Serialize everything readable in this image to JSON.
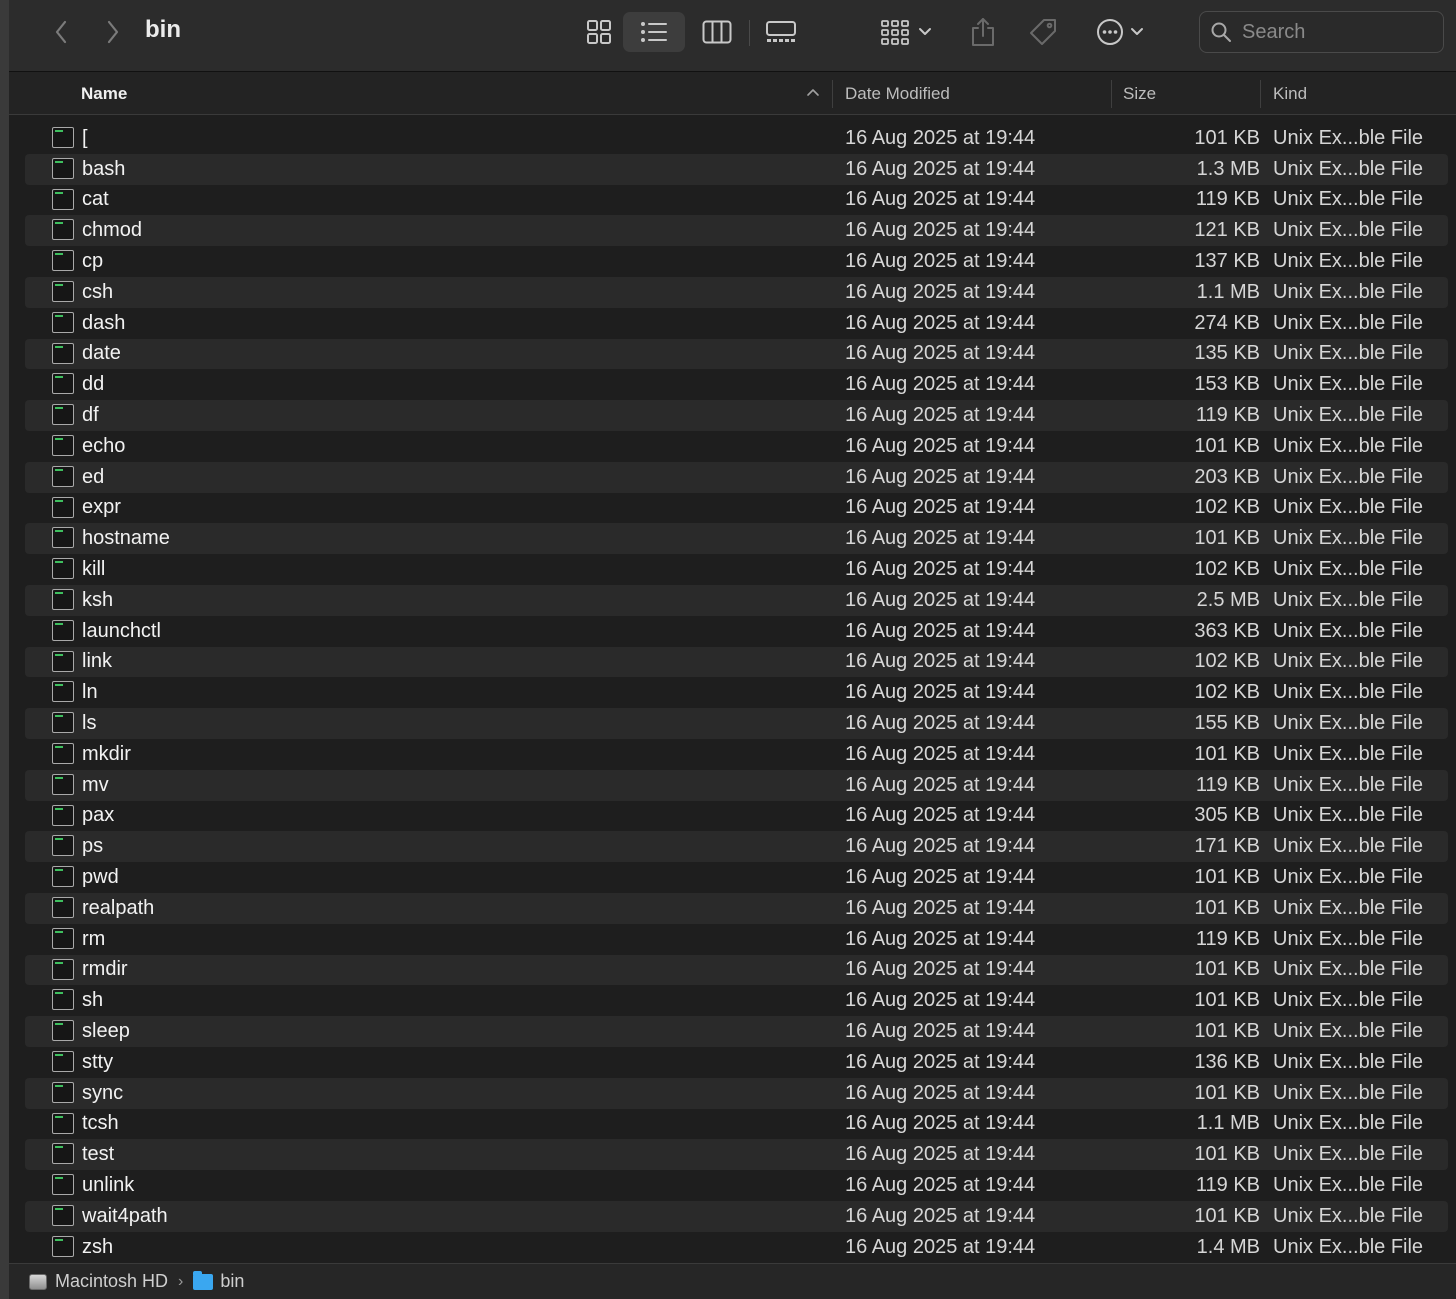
{
  "toolbar": {
    "title": "bin",
    "search_placeholder": "Search"
  },
  "columns": {
    "name": "Name",
    "date": "Date Modified",
    "size": "Size",
    "kind": "Kind"
  },
  "files": [
    {
      "name": "[",
      "date": "16 Aug 2025 at 19:44",
      "size": "101 KB",
      "kind": "Unix Ex...ble File"
    },
    {
      "name": "bash",
      "date": "16 Aug 2025 at 19:44",
      "size": "1.3 MB",
      "kind": "Unix Ex...ble File"
    },
    {
      "name": "cat",
      "date": "16 Aug 2025 at 19:44",
      "size": "119 KB",
      "kind": "Unix Ex...ble File"
    },
    {
      "name": "chmod",
      "date": "16 Aug 2025 at 19:44",
      "size": "121 KB",
      "kind": "Unix Ex...ble File"
    },
    {
      "name": "cp",
      "date": "16 Aug 2025 at 19:44",
      "size": "137 KB",
      "kind": "Unix Ex...ble File"
    },
    {
      "name": "csh",
      "date": "16 Aug 2025 at 19:44",
      "size": "1.1 MB",
      "kind": "Unix Ex...ble File"
    },
    {
      "name": "dash",
      "date": "16 Aug 2025 at 19:44",
      "size": "274 KB",
      "kind": "Unix Ex...ble File"
    },
    {
      "name": "date",
      "date": "16 Aug 2025 at 19:44",
      "size": "135 KB",
      "kind": "Unix Ex...ble File"
    },
    {
      "name": "dd",
      "date": "16 Aug 2025 at 19:44",
      "size": "153 KB",
      "kind": "Unix Ex...ble File"
    },
    {
      "name": "df",
      "date": "16 Aug 2025 at 19:44",
      "size": "119 KB",
      "kind": "Unix Ex...ble File"
    },
    {
      "name": "echo",
      "date": "16 Aug 2025 at 19:44",
      "size": "101 KB",
      "kind": "Unix Ex...ble File"
    },
    {
      "name": "ed",
      "date": "16 Aug 2025 at 19:44",
      "size": "203 KB",
      "kind": "Unix Ex...ble File"
    },
    {
      "name": "expr",
      "date": "16 Aug 2025 at 19:44",
      "size": "102 KB",
      "kind": "Unix Ex...ble File"
    },
    {
      "name": "hostname",
      "date": "16 Aug 2025 at 19:44",
      "size": "101 KB",
      "kind": "Unix Ex...ble File"
    },
    {
      "name": "kill",
      "date": "16 Aug 2025 at 19:44",
      "size": "102 KB",
      "kind": "Unix Ex...ble File"
    },
    {
      "name": "ksh",
      "date": "16 Aug 2025 at 19:44",
      "size": "2.5 MB",
      "kind": "Unix Ex...ble File"
    },
    {
      "name": "launchctl",
      "date": "16 Aug 2025 at 19:44",
      "size": "363 KB",
      "kind": "Unix Ex...ble File"
    },
    {
      "name": "link",
      "date": "16 Aug 2025 at 19:44",
      "size": "102 KB",
      "kind": "Unix Ex...ble File"
    },
    {
      "name": "ln",
      "date": "16 Aug 2025 at 19:44",
      "size": "102 KB",
      "kind": "Unix Ex...ble File"
    },
    {
      "name": "ls",
      "date": "16 Aug 2025 at 19:44",
      "size": "155 KB",
      "kind": "Unix Ex...ble File"
    },
    {
      "name": "mkdir",
      "date": "16 Aug 2025 at 19:44",
      "size": "101 KB",
      "kind": "Unix Ex...ble File"
    },
    {
      "name": "mv",
      "date": "16 Aug 2025 at 19:44",
      "size": "119 KB",
      "kind": "Unix Ex...ble File"
    },
    {
      "name": "pax",
      "date": "16 Aug 2025 at 19:44",
      "size": "305 KB",
      "kind": "Unix Ex...ble File"
    },
    {
      "name": "ps",
      "date": "16 Aug 2025 at 19:44",
      "size": "171 KB",
      "kind": "Unix Ex...ble File"
    },
    {
      "name": "pwd",
      "date": "16 Aug 2025 at 19:44",
      "size": "101 KB",
      "kind": "Unix Ex...ble File"
    },
    {
      "name": "realpath",
      "date": "16 Aug 2025 at 19:44",
      "size": "101 KB",
      "kind": "Unix Ex...ble File"
    },
    {
      "name": "rm",
      "date": "16 Aug 2025 at 19:44",
      "size": "119 KB",
      "kind": "Unix Ex...ble File"
    },
    {
      "name": "rmdir",
      "date": "16 Aug 2025 at 19:44",
      "size": "101 KB",
      "kind": "Unix Ex...ble File"
    },
    {
      "name": "sh",
      "date": "16 Aug 2025 at 19:44",
      "size": "101 KB",
      "kind": "Unix Ex...ble File"
    },
    {
      "name": "sleep",
      "date": "16 Aug 2025 at 19:44",
      "size": "101 KB",
      "kind": "Unix Ex...ble File"
    },
    {
      "name": "stty",
      "date": "16 Aug 2025 at 19:44",
      "size": "136 KB",
      "kind": "Unix Ex...ble File"
    },
    {
      "name": "sync",
      "date": "16 Aug 2025 at 19:44",
      "size": "101 KB",
      "kind": "Unix Ex...ble File"
    },
    {
      "name": "tcsh",
      "date": "16 Aug 2025 at 19:44",
      "size": "1.1 MB",
      "kind": "Unix Ex...ble File"
    },
    {
      "name": "test",
      "date": "16 Aug 2025 at 19:44",
      "size": "101 KB",
      "kind": "Unix Ex...ble File"
    },
    {
      "name": "unlink",
      "date": "16 Aug 2025 at 19:44",
      "size": "119 KB",
      "kind": "Unix Ex...ble File"
    },
    {
      "name": "wait4path",
      "date": "16 Aug 2025 at 19:44",
      "size": "101 KB",
      "kind": "Unix Ex...ble File"
    },
    {
      "name": "zsh",
      "date": "16 Aug 2025 at 19:44",
      "size": "1.4 MB",
      "kind": "Unix Ex...ble File"
    }
  ],
  "pathbar": {
    "volume": "Macintosh HD",
    "folder": "bin"
  },
  "icons": {
    "back": "chevron-left-icon",
    "forward": "chevron-right-icon",
    "icon_view": "grid-icon",
    "list_view": "list-icon",
    "column_view": "columns-icon",
    "gallery_view": "gallery-icon",
    "group": "group-icon",
    "share": "share-icon",
    "tag": "tag-icon",
    "more": "ellipsis-circle-icon",
    "search": "magnifier-icon",
    "file": "terminal-file-icon"
  },
  "colors": {
    "background": "#1e1e1e",
    "toolbar": "#2c2c2c",
    "row_alt": "#2a2a2a",
    "folder": "#3aa7f0"
  }
}
